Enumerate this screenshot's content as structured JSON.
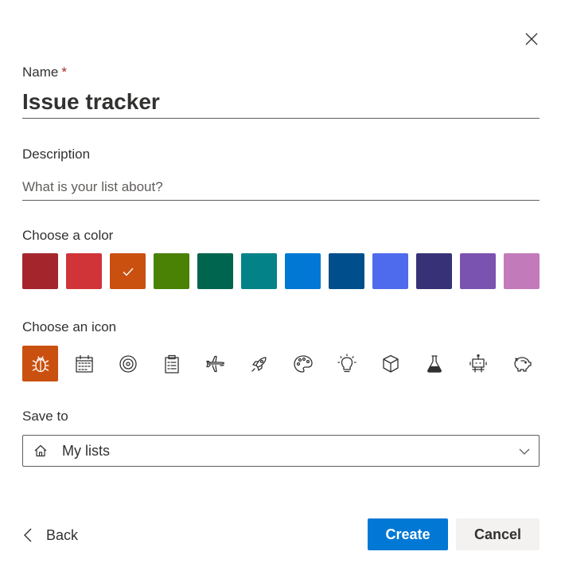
{
  "dialog": {
    "close_icon": "close-icon"
  },
  "name": {
    "label": "Name",
    "required_mark": "*",
    "value": "Issue tracker"
  },
  "description": {
    "label": "Description",
    "value": "",
    "placeholder": "What is your list about?"
  },
  "color": {
    "label": "Choose a color",
    "selected_index": 2,
    "swatches": [
      "#a4262c",
      "#d13438",
      "#ca5010",
      "#498205",
      "#00654f",
      "#038387",
      "#0078d4",
      "#004e8c",
      "#4f6bed",
      "#373277",
      "#7a53b0",
      "#c27abb"
    ]
  },
  "icon": {
    "label": "Choose an icon",
    "selected_index": 0,
    "items": [
      "bug-icon",
      "calendar-icon",
      "target-icon",
      "clipboard-icon",
      "airplane-icon",
      "rocket-icon",
      "palette-icon",
      "lightbulb-icon",
      "cube-icon",
      "flask-icon",
      "robot-icon",
      "piggy-bank-icon"
    ]
  },
  "save_to": {
    "label": "Save to",
    "value": "My lists",
    "icon": "home-icon"
  },
  "footer": {
    "back_label": "Back",
    "create_label": "Create",
    "cancel_label": "Cancel",
    "create_color": "#0078d4"
  }
}
